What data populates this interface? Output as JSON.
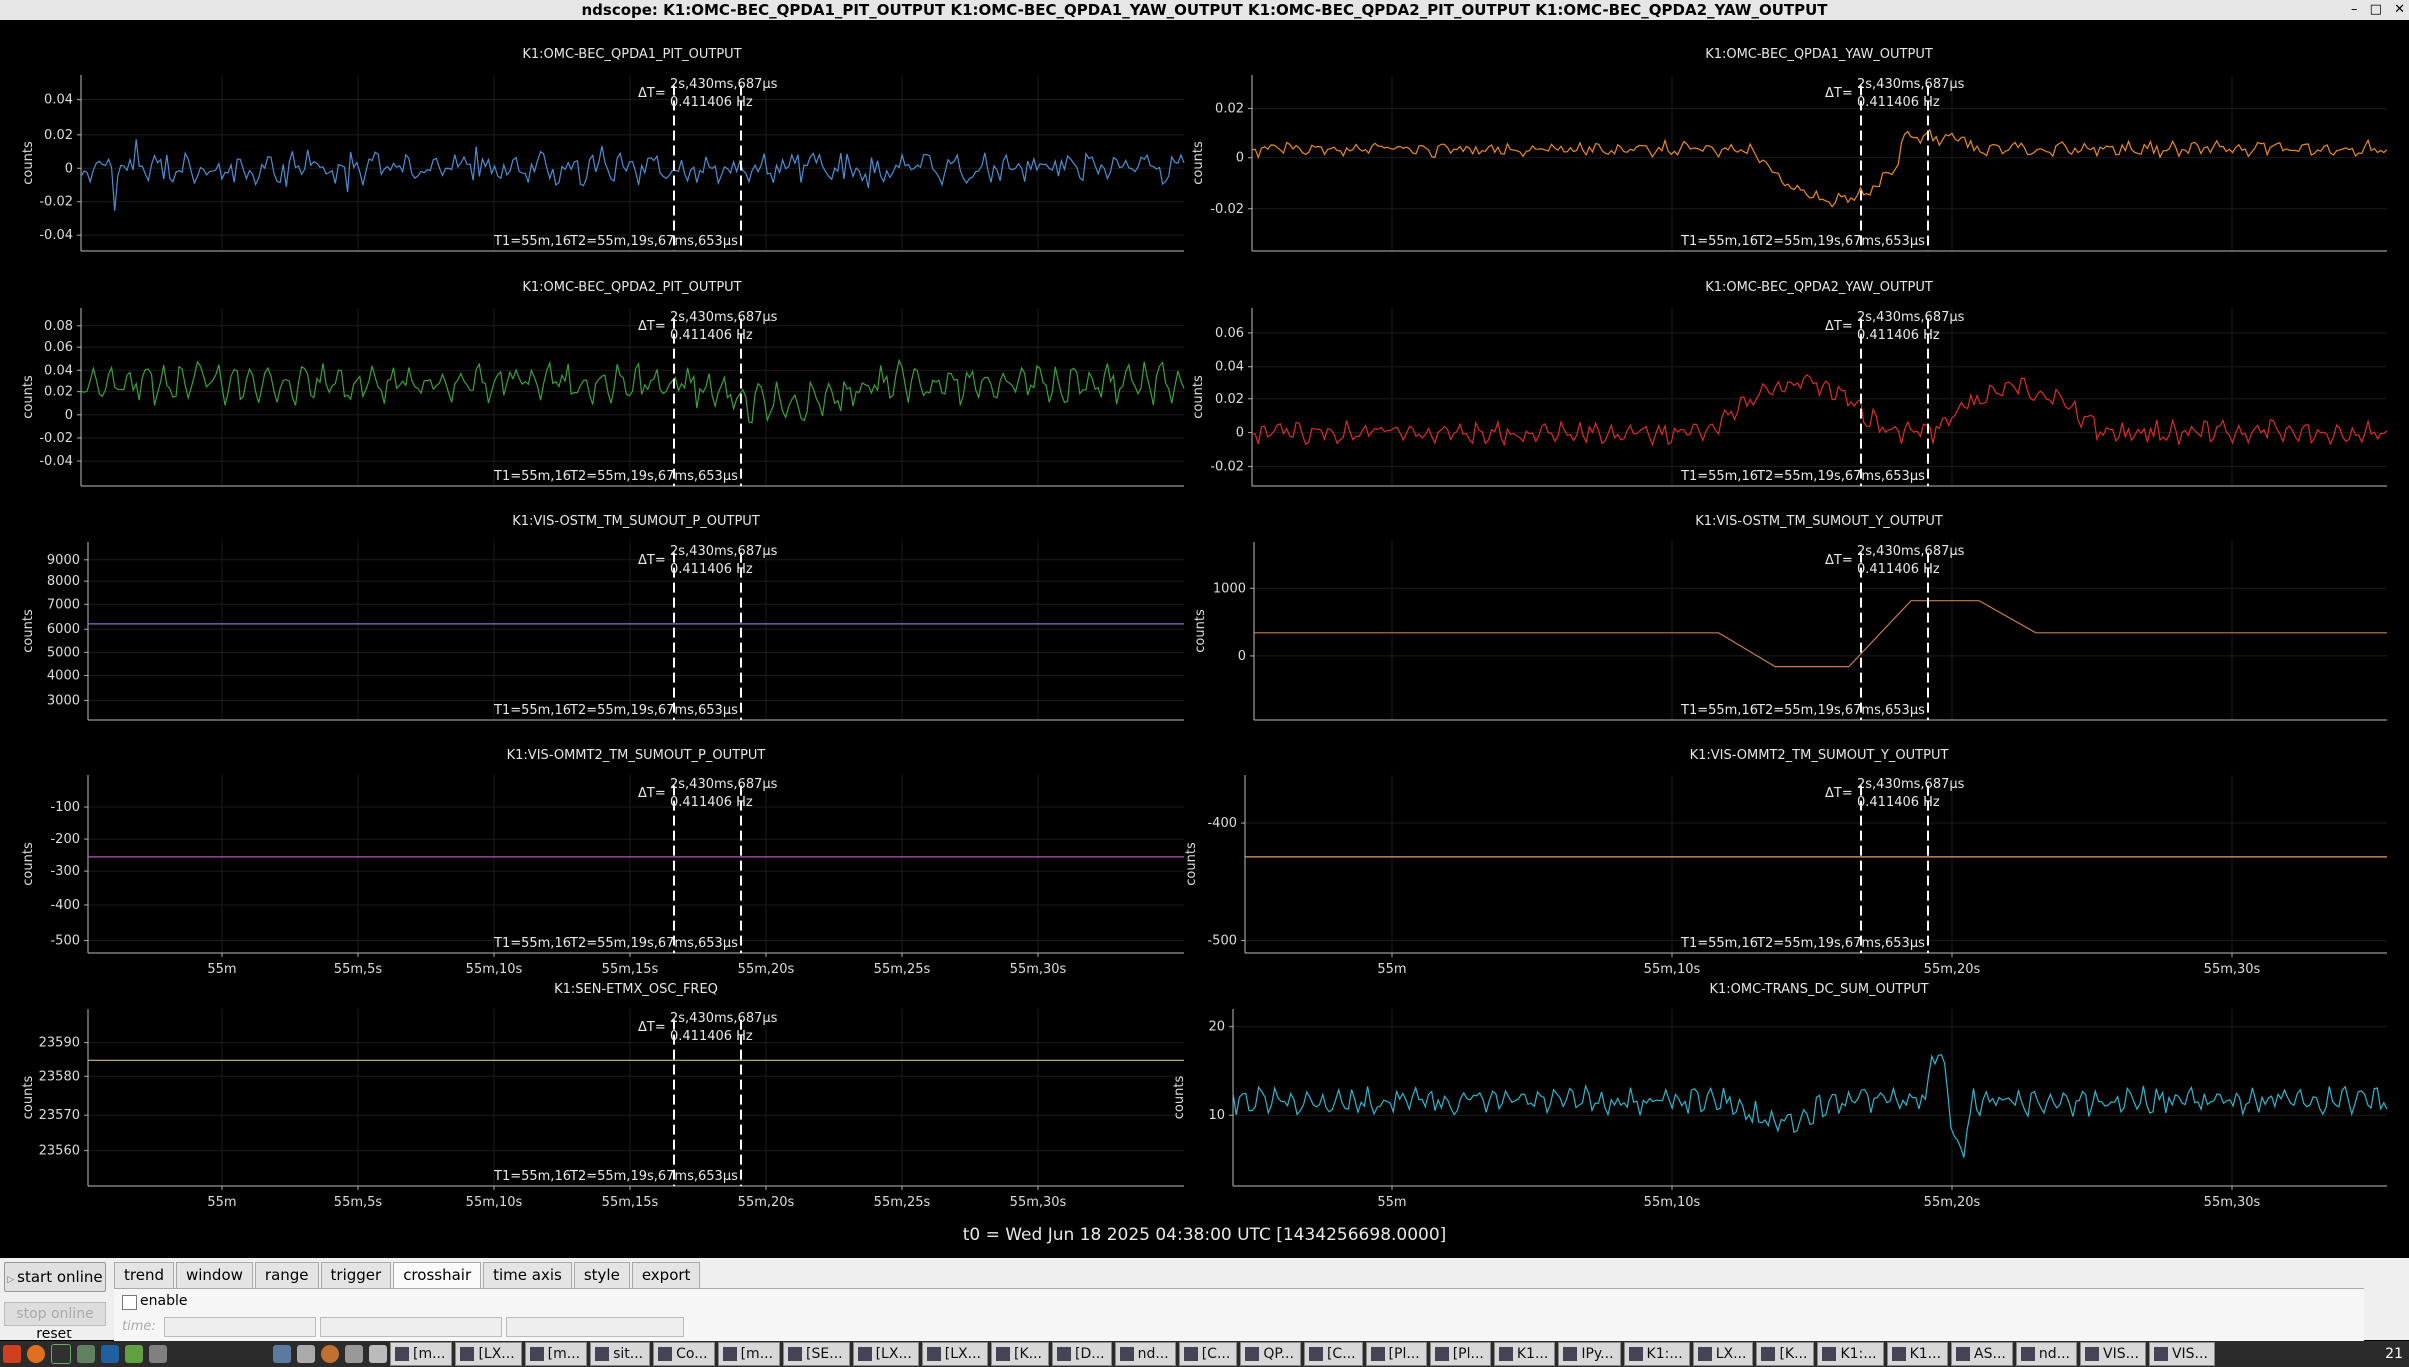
{
  "window": {
    "title": "ndscope: K1:OMC-BEC_QPDA1_PIT_OUTPUT K1:OMC-BEC_QPDA1_YAW_OUTPUT K1:OMC-BEC_QPDA2_PIT_OUTPUT K1:OMC-BEC_QPDA2_YAW_OUTPUT",
    "minimize": "–",
    "maximize": "□",
    "close": "✕"
  },
  "crosshair": {
    "dt_prefix": "ΔT=",
    "dt": "2s,430ms,687μs",
    "freq": "0.411406 Hz",
    "t1": "T1=55m,16",
    "t2": "T2=55m,19s,67ms,653μs"
  },
  "t0_label": "t0 = Wed Jun 18 2025 04:38:00 UTC [1434256698.0000]",
  "colors": {
    "blue": "#4a8fd6",
    "orange": "#f08a1e",
    "green": "#3aa23a",
    "red": "#e02a2a",
    "slate": "#7a7ad0",
    "brown": "#c87a4a",
    "magenta": "#c050c0",
    "tan": "#e8a060",
    "olive": "#c8c070",
    "cyan": "#2ab8d0"
  },
  "plots": [
    {
      "id": "p1",
      "channel": "K1:OMC-BEC_QPDA1_PIT_OUTPUT",
      "ylabel": "counts",
      "yticks": [
        "0.04",
        "0.02",
        "0",
        "-0.02",
        "-0.04"
      ],
      "color": "blue",
      "xticks": []
    },
    {
      "id": "p2",
      "channel": "K1:OMC-BEC_QPDA1_YAW_OUTPUT",
      "ylabel": "counts",
      "yticks": [
        "0.02",
        "0",
        "-0.02"
      ],
      "color": "orange",
      "xticks": []
    },
    {
      "id": "p3",
      "channel": "K1:OMC-BEC_QPDA2_PIT_OUTPUT",
      "ylabel": "counts",
      "yticks": [
        "0.08",
        "0.06",
        "0.04",
        "0.02",
        "0",
        "-0.02",
        "-0.04"
      ],
      "color": "green",
      "xticks": []
    },
    {
      "id": "p4",
      "channel": "K1:OMC-BEC_QPDA2_YAW_OUTPUT",
      "ylabel": "counts",
      "yticks": [
        "0.06",
        "0.04",
        "0.02",
        "0",
        "-0.02"
      ],
      "color": "red",
      "xticks": []
    },
    {
      "id": "p5",
      "channel": "K1:VIS-OSTM_TM_SUMOUT_P_OUTPUT",
      "ylabel": "counts",
      "yticks": [
        "9000",
        "8000",
        "7000",
        "6000",
        "5000",
        "4000",
        "3000"
      ],
      "color": "slate",
      "xticks": []
    },
    {
      "id": "p6",
      "channel": "K1:VIS-OSTM_TM_SUMOUT_Y_OUTPUT",
      "ylabel": "counts",
      "yticks": [
        "1000",
        "0"
      ],
      "color": "brown",
      "xticks": []
    },
    {
      "id": "p7",
      "channel": "K1:VIS-OMMT2_TM_SUMOUT_P_OUTPUT",
      "ylabel": "counts",
      "yticks": [
        "-100",
        "-200",
        "-300",
        "-400",
        "-500"
      ],
      "color": "magenta",
      "xticks": [
        "55m",
        "55m,5s",
        "55m,10s",
        "55m,15s",
        "55m,20s",
        "55m,25s",
        "55m,30s"
      ]
    },
    {
      "id": "p8",
      "channel": "K1:VIS-OMMT2_TM_SUMOUT_Y_OUTPUT",
      "ylabel": "counts",
      "yticks": [
        "-400",
        "-500"
      ],
      "color": "tan",
      "xticks": [
        "55m",
        "55m,10s",
        "55m,20s",
        "55m,30s"
      ]
    },
    {
      "id": "p9",
      "channel": "K1:SEN-ETMX_OSC_FREQ",
      "ylabel": "counts",
      "yticks": [
        "23590",
        "23580",
        "23570",
        "23560"
      ],
      "color": "olive",
      "xticks": [
        "55m",
        "55m,5s",
        "55m,10s",
        "55m,15s",
        "55m,20s",
        "55m,25s",
        "55m,30s"
      ]
    },
    {
      "id": "p10",
      "channel": "K1:OMC-TRANS_DC_SUM_OUTPUT",
      "ylabel": "counts",
      "yticks": [
        "20",
        "10"
      ],
      "color": "cyan",
      "xticks": [
        "55m",
        "55m,10s",
        "55m,20s",
        "55m,30s"
      ]
    }
  ],
  "controls": {
    "start_online": "start online",
    "stop_online": "stop online",
    "reset": "reset",
    "tabs": [
      "trend",
      "window",
      "range",
      "trigger",
      "crosshair",
      "time axis",
      "style",
      "export"
    ],
    "active_tab": "crosshair",
    "enable_label": "enable",
    "time_label": "time:"
  },
  "taskbar": {
    "items": [
      "[m...",
      "[LX...",
      "[m...",
      "sit...",
      "Co...",
      "[m...",
      "[SE...",
      "[LX...",
      "[LX...",
      "[K...",
      "[D...",
      "nd...",
      "[C...",
      "QP...",
      "[C...",
      "[Pl...",
      "[Pl...",
      "K1...",
      "IPy...",
      "K1:...",
      "LX...",
      "[K...",
      "K1:...",
      "K1...",
      "AS...",
      "nd...",
      "VIS...",
      "VIS..."
    ],
    "clock": "21"
  }
}
